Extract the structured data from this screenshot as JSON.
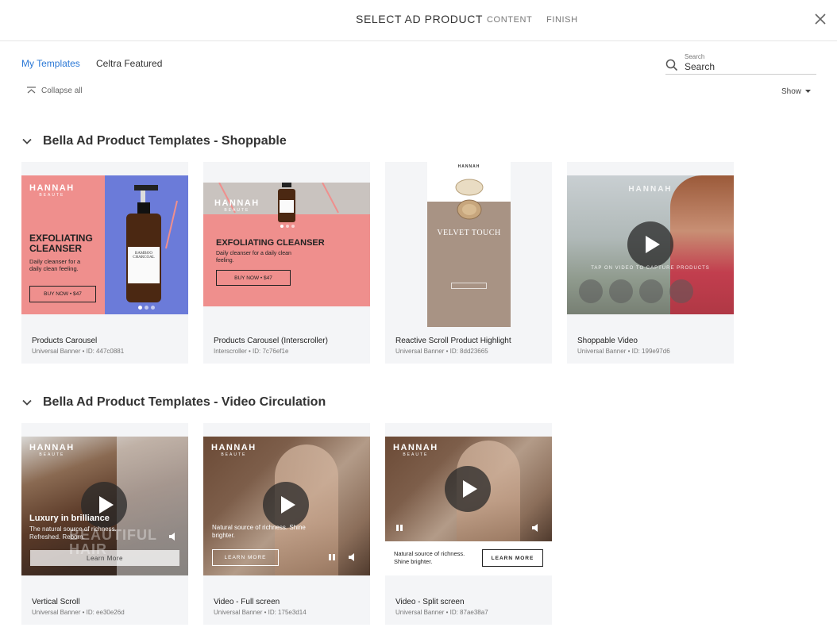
{
  "header": {
    "steps": {
      "current": "SELECT AD PRODUCT",
      "content": "CONTENT",
      "finish": "FINISH"
    }
  },
  "tabs": {
    "my_templates": "My Templates",
    "celtra_featured": "Celtra Featured"
  },
  "search": {
    "label": "Search",
    "placeholder": "Search"
  },
  "toolbar": {
    "collapse_all": "Collapse all",
    "show": "Show"
  },
  "sections": [
    {
      "title": "Bella Ad Product Templates - Shoppable",
      "cards": [
        {
          "name": "Products Carousel",
          "meta": "Universal Banner • ID: 447c0881",
          "thumb": {
            "brand": "HANNAH",
            "sub": "BEAUTE",
            "headline": "EXFOLIATING CLEANSER",
            "body": "Daily cleanser for a daily clean feeling.",
            "cta": "BUY NOW • $47",
            "bottle_label": "BAMBOO CHARCOAL"
          }
        },
        {
          "name": "Products Carousel (Interscroller)",
          "meta": "Interscroller • ID: 7c76ef1e",
          "thumb": {
            "brand": "HANNAH",
            "sub": "BEAUTE",
            "headline": "EXFOLIATING CLEANSER",
            "body": "Daily cleanser for a daily clean feeling.",
            "cta": "BUY NOW • $47"
          }
        },
        {
          "name": "Reactive Scroll Product Highlight",
          "meta": "Universal Banner • ID: 8dd23665",
          "thumb": {
            "brand": "HANNAH",
            "headline": "VELVET TOUCH"
          }
        },
        {
          "name": "Shoppable Video",
          "meta": "Universal Banner • ID: 199e97d6",
          "thumb": {
            "brand": "HANNAH",
            "caption": "TAP ON VIDEO TO CAPTURE PRODUCTS"
          }
        }
      ]
    },
    {
      "title": "Bella Ad Product Templates - Video Circulation",
      "cards": [
        {
          "name": "Vertical Scroll",
          "meta": "Universal Banner • ID: ee30e26d",
          "thumb": {
            "brand": "HANNAH",
            "sub": "BEAUTE",
            "headline": "Luxury in brilliance",
            "body": "The natural source of richness. Refreshed. Reborn.",
            "watermark": "BEAUTIFUL HAIR",
            "cta": "Learn More"
          }
        },
        {
          "name": "Video - Full screen",
          "meta": "Universal Banner • ID: 175e3d14",
          "thumb": {
            "brand": "HANNAH",
            "sub": "BEAUTE",
            "body": "Natural source of richness. Shine brighter.",
            "cta": "LEARN MORE"
          }
        },
        {
          "name": "Video - Split screen",
          "meta": "Universal Banner • ID: 87ae38a7",
          "thumb": {
            "brand": "HANNAH",
            "sub": "BEAUTE",
            "body": "Natural source of richness. Shine brighter.",
            "cta": "LEARN MORE"
          }
        }
      ]
    }
  ],
  "colors": {
    "accent": "#2b78d6",
    "coral": "#ef8f8d",
    "periwinkle": "#6b7bd9"
  }
}
